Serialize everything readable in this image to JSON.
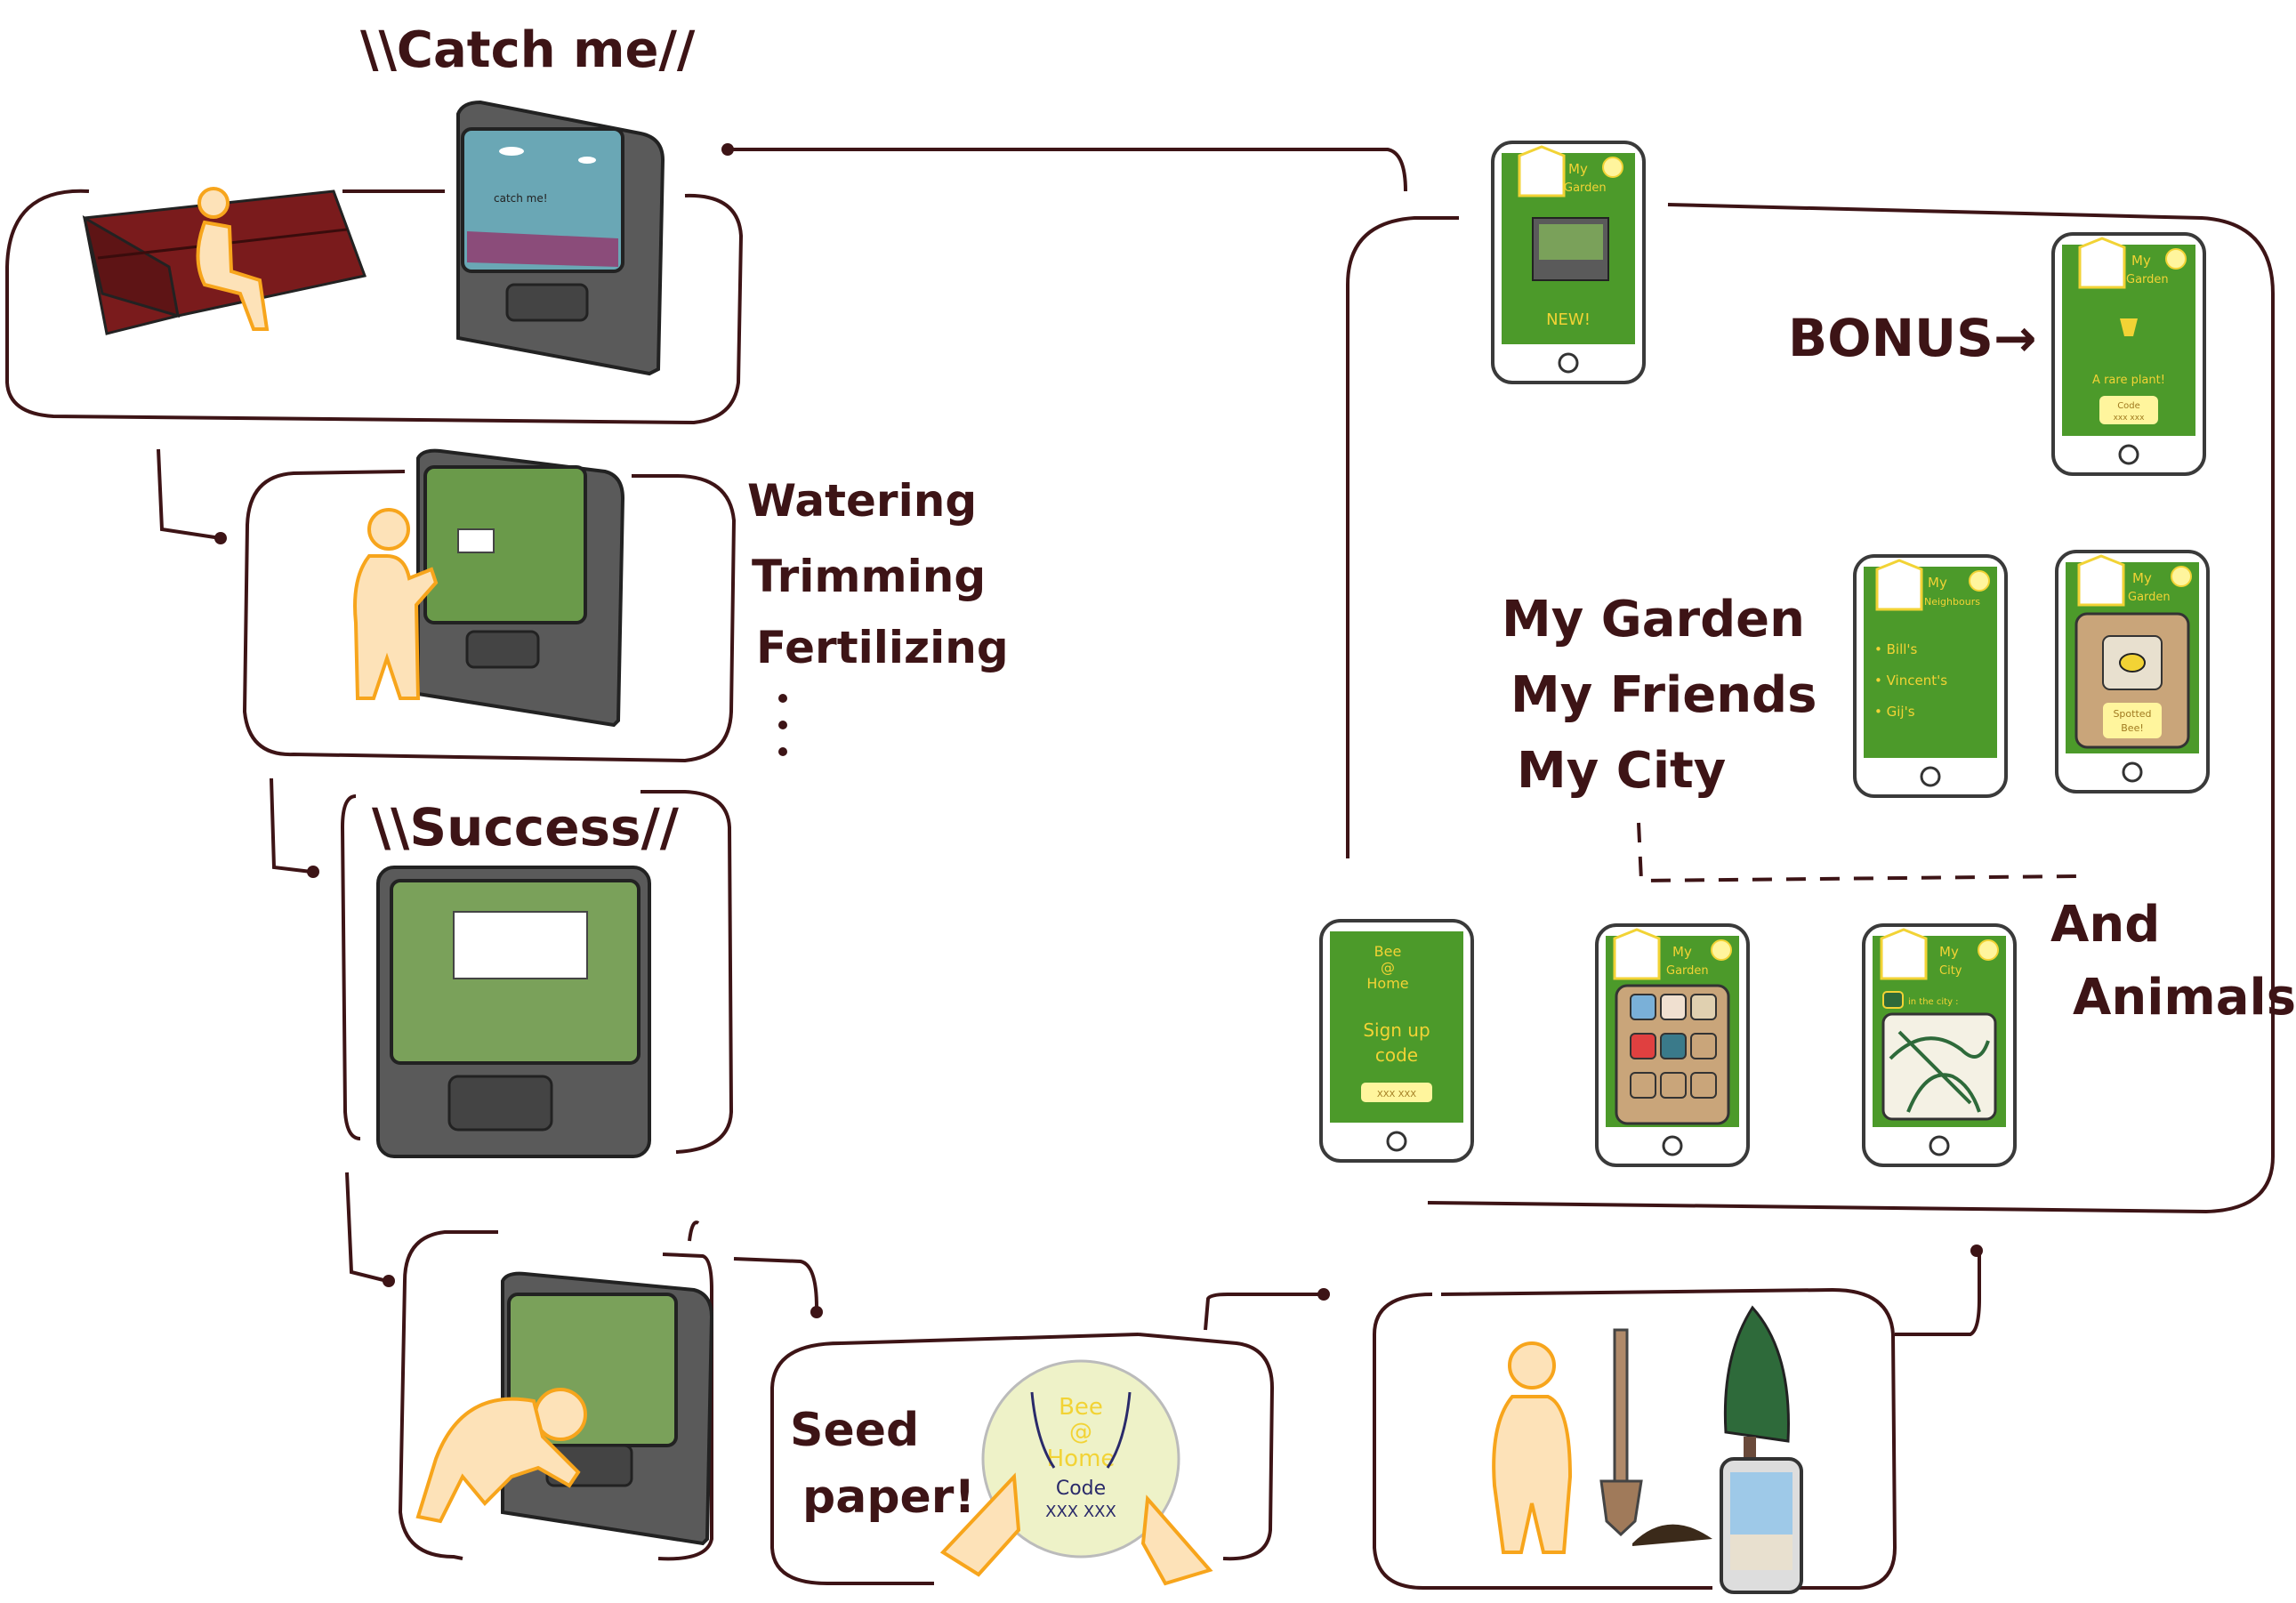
{
  "labels": {
    "catch_me": "\\\\Catch me//",
    "actions": [
      "Watering",
      "Trimming",
      "Fertilizing"
    ],
    "more_dots": "⋮",
    "success": "\\\\Success//",
    "bonus": "BONUS→",
    "sections": [
      "My Garden",
      "My Friends",
      "My City"
    ],
    "and_animals_1": "And",
    "and_animals_2": "Animals",
    "seed_paper_1": "Seed",
    "seed_paper_2": "paper!"
  },
  "kiosk_screen": {
    "catch_me_small": "catch me!"
  },
  "seed_card": {
    "brand_1": "Bee",
    "brand_2": "@",
    "brand_3": "Home",
    "code_label": "Code",
    "code_value": "XXX XXX"
  },
  "phones": {
    "garden_new": {
      "title_1": "My",
      "title_2": "Garden",
      "badge": "NEW!"
    },
    "bonus": {
      "title_1": "My",
      "title_2": "Garden",
      "message": "A rare plant!",
      "code_label": "Code",
      "code_value": "xxx xxx"
    },
    "neighbours": {
      "title_1": "My",
      "title_2": "Neighbours",
      "items": [
        "• Bill's",
        "• Vincent's",
        "• Gij's"
      ]
    },
    "spotted": {
      "title_1": "My",
      "title_2": "Garden",
      "message_1": "Spotted",
      "message_2": "Bee!"
    },
    "signup": {
      "brand_1": "Bee",
      "brand_2": "@",
      "brand_3": "Home",
      "line_1": "Sign up",
      "line_2": "code",
      "code_value": "XXX XXX"
    },
    "garden_grid": {
      "title_1": "My",
      "title_2": "Garden"
    },
    "city": {
      "title_1": "My",
      "title_2": "City",
      "caption": "in the city :"
    }
  },
  "colors": {
    "ink": "#3d1416",
    "phone_green": "#4c9a2a",
    "accent_yellow": "#f2d335",
    "person": "#fde2b8",
    "person_outline": "#f7a51c",
    "bench": "#7a1b1c",
    "kiosk": "#5a5a5a",
    "sky": "#6aa7b5"
  }
}
